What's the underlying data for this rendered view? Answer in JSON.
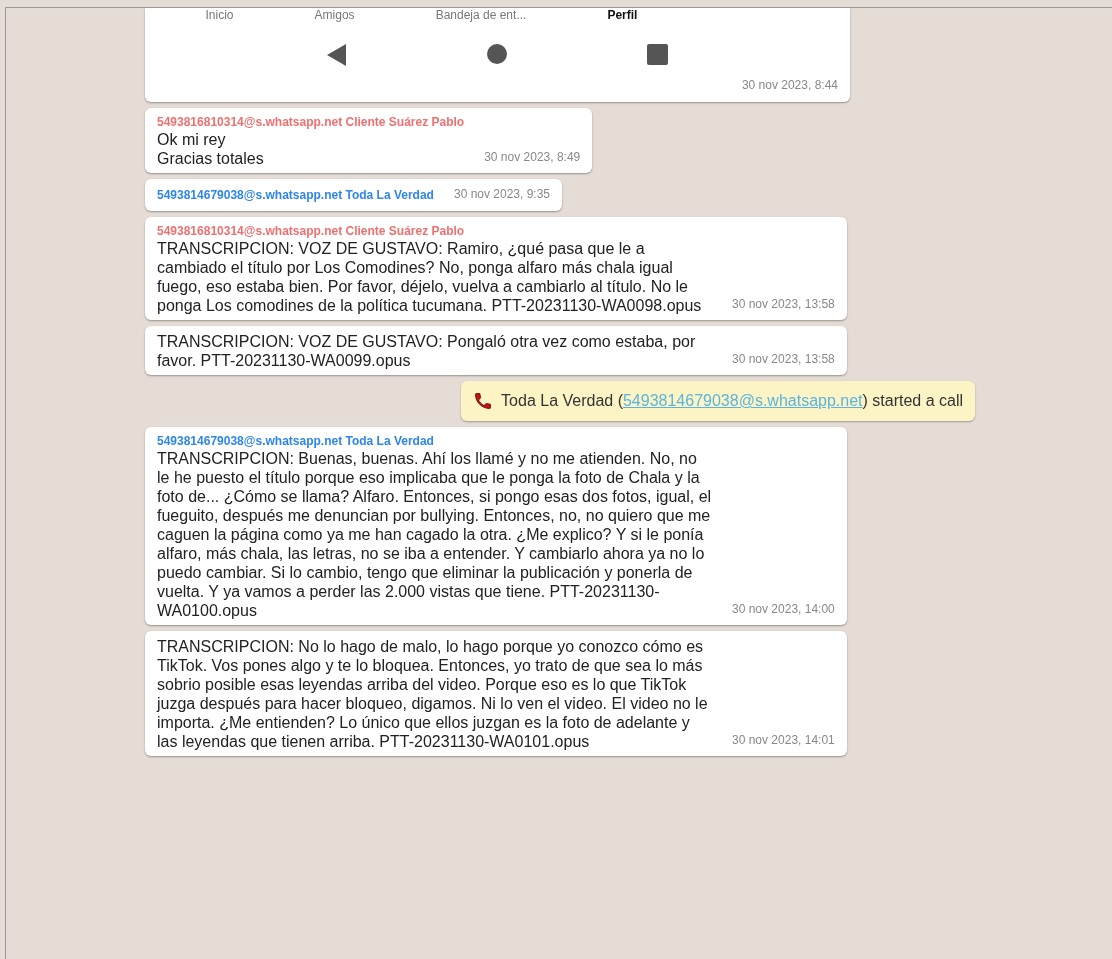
{
  "messages": [
    {
      "kind": "screenshot",
      "nav_tabs": [
        {
          "label": "Inicio",
          "selected": false
        },
        {
          "label": "Amigos",
          "selected": false
        },
        {
          "label": "Bandeja de ent...",
          "selected": false
        },
        {
          "label": "Perfil",
          "selected": true
        }
      ],
      "time": "30 nov 2023, 8:44"
    },
    {
      "kind": "text",
      "sender": "5493816810314@s.whatsapp.net Cliente Suárez Pablo",
      "color": "#f07070",
      "text": "Ok mi rey\nGracias totales",
      "time": "30 nov 2023, 8:49"
    },
    {
      "kind": "text",
      "sender": "5493814679038@s.whatsapp.net Toda La Verdad",
      "color": "#2f86e8",
      "time": "30 nov 2023, 9:35"
    },
    {
      "kind": "text",
      "sender": "5493816810314@s.whatsapp.net Cliente Suárez Pablo",
      "color": "#f07070",
      "text": "TRANSCRIPCION: VOZ DE GUSTAVO: Ramiro, ¿qué pasa que le a cambiado el título por Los Comodines? No, ponga alfaro más chala igual fuego, eso estaba bien. Por favor, déjelo, vuelva a cambiarlo al título. No le ponga Los comodines de la política tucumana. PTT-20231130-WA0098.opus",
      "time": "30 nov 2023, 13:58"
    },
    {
      "kind": "text",
      "text": "TRANSCRIPCION: VOZ DE GUSTAVO: Pongaló otra vez como estaba, por favor. PTT-20231130-WA0099.opus",
      "time": "30 nov 2023, 13:58"
    },
    {
      "kind": "system",
      "name": "Toda La Verdad (",
      "link": "5493814679038@s.whatsapp.net",
      "rest": ") started a call"
    },
    {
      "kind": "text",
      "sender": "5493814679038@s.whatsapp.net Toda La Verdad",
      "color": "#2f86e8",
      "text": "TRANSCRIPCION: Buenas, buenas. Ahí los llamé y no me atienden. No, no le he puesto el título porque eso implicaba que le ponga la foto de Chala y la foto de... ¿Cómo se llama? Alfaro. Entonces, si pongo esas dos fotos, igual, el fueguito, después me denuncian por bullying. Entonces, no, no quiero que me caguen la página como ya me han cagado la otra. ¿Me explico? Y si le ponía alfaro, más chala, las letras, no se iba a entender. Y cambiarlo ahora ya no lo puedo cambiar. Si lo cambio, tengo que eliminar la publicación y ponerla de vuelta. Y ya vamos a perder las 2.000 vistas que tiene. PTT-20231130-WA0100.opus",
      "time": "30 nov 2023, 14:00"
    },
    {
      "kind": "text",
      "text": "TRANSCRIPCION: No lo hago de malo, lo hago porque yo conozco cómo es TikTok. Vos pones algo y te lo bloquea. Entonces, yo trato de que sea lo más sobrio posible esas leyendas arriba del video. Porque eso es lo que TikTok juzga después para hacer bloqueo, digamos. Ni lo ven el video. El video no le importa. ¿Me entienden? Lo único que ellos juzgan es la foto de adelante y las leyendas que tienen arriba. PTT-20231130-WA0101.opus",
      "time": "30 nov 2023, 14:01"
    }
  ]
}
